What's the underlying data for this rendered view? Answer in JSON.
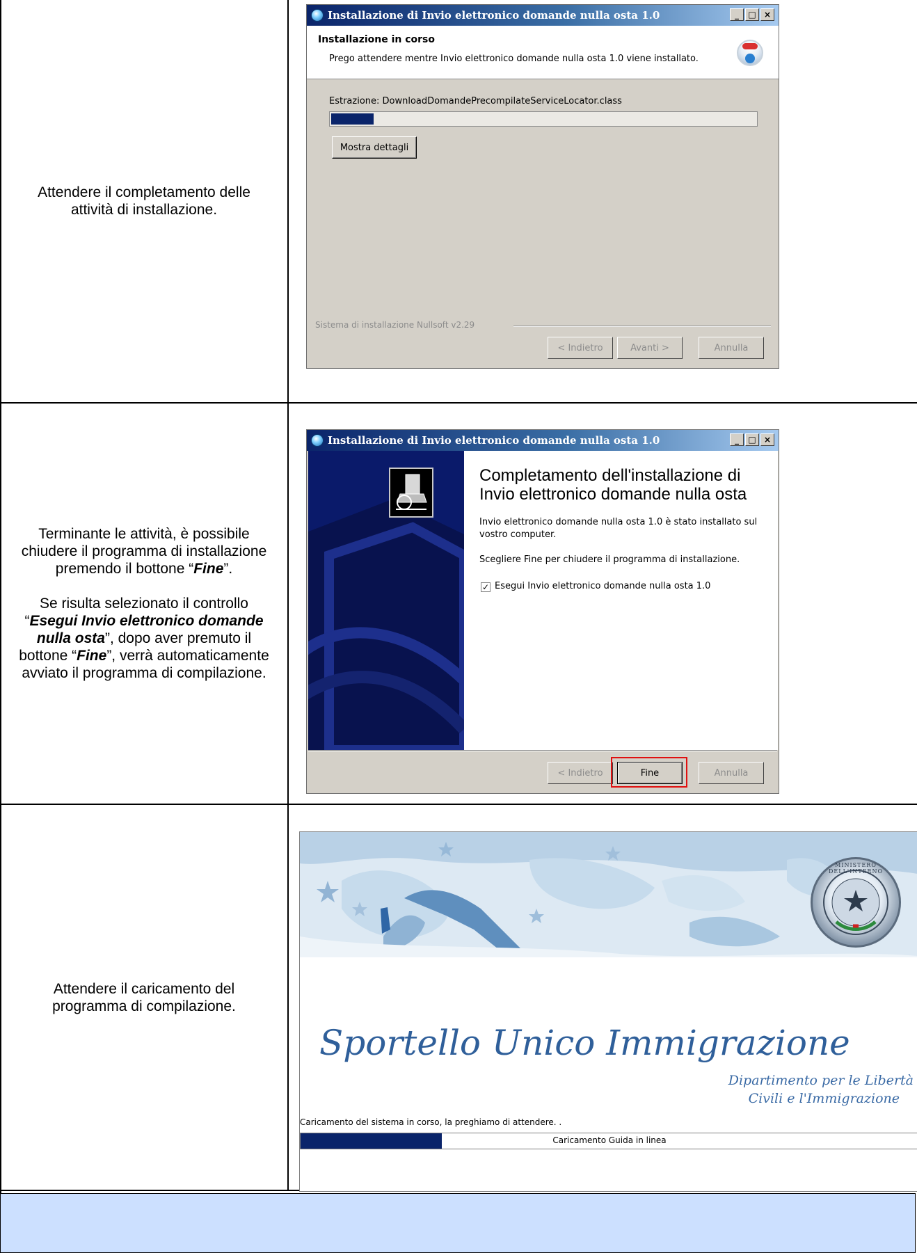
{
  "rows": [
    {
      "instruction": "Attendere il completamento delle attività di installazione."
    },
    {
      "instruction_parts": [
        "Terminante le attività, è possibile chiudere il programma di installazione premendo il bottone “",
        "Fine",
        "”.",
        "Se risulta selezionato il controllo “",
        "Esegui Invio elettronico domande nulla osta",
        "”, dopo aver premuto il bottone “",
        "Fine",
        "”, verrà automaticamente avviato il programma di compilazione."
      ]
    },
    {
      "instruction": "Attendere il caricamento del programma di compilazione."
    }
  ],
  "installer_progress": {
    "title": "Installazione di Invio elettronico domande nulla osta 1.0",
    "header_title": "Installazione in corso",
    "header_subtitle": "Prego attendere mentre Invio elettronico domande nulla osta 1.0  viene installato.",
    "status": "Estrazione: DownloadDomandePrecompilateServiceLocator.class",
    "progress_fraction": 0.1,
    "details_button": "Mostra dettagli",
    "branding": "Sistema di installazione Nullsoft v2.29",
    "buttons": {
      "back": "< Indietro",
      "next": "Avanti >",
      "cancel": "Annulla"
    }
  },
  "installer_finish": {
    "title": "Installazione di Invio elettronico domande nulla osta 1.0",
    "heading": "Completamento dell'installazione di Invio elettronico domande nulla osta 1.0",
    "text1": "Invio elettronico domande nulla osta 1.0 è stato installato sul vostro computer.",
    "text2": "Scegliere Fine per chiudere il programma di installazione.",
    "checkbox_label": "Esegui Invio elettronico domande nulla osta 1.0",
    "checkbox_checked": true,
    "buttons": {
      "back": "< Indietro",
      "finish": "Fine",
      "cancel": "Annulla"
    }
  },
  "splash": {
    "emblem_text": "MINISTERO DELL'INTERNO",
    "title": "Sportello Unico Immigrazione",
    "subtitle_line1": "Dipartimento per le Libertà",
    "subtitle_line2": "Civili e l'Immigrazione",
    "loading_text": "Caricamento del sistema in corso, la preghiamo di attendere. .",
    "progress_label": "Caricamento Guida in linea"
  },
  "colors": {
    "highlight_border": "#e01010",
    "progress_fill": "#0a246a",
    "table_footer": "#cce0ff"
  }
}
